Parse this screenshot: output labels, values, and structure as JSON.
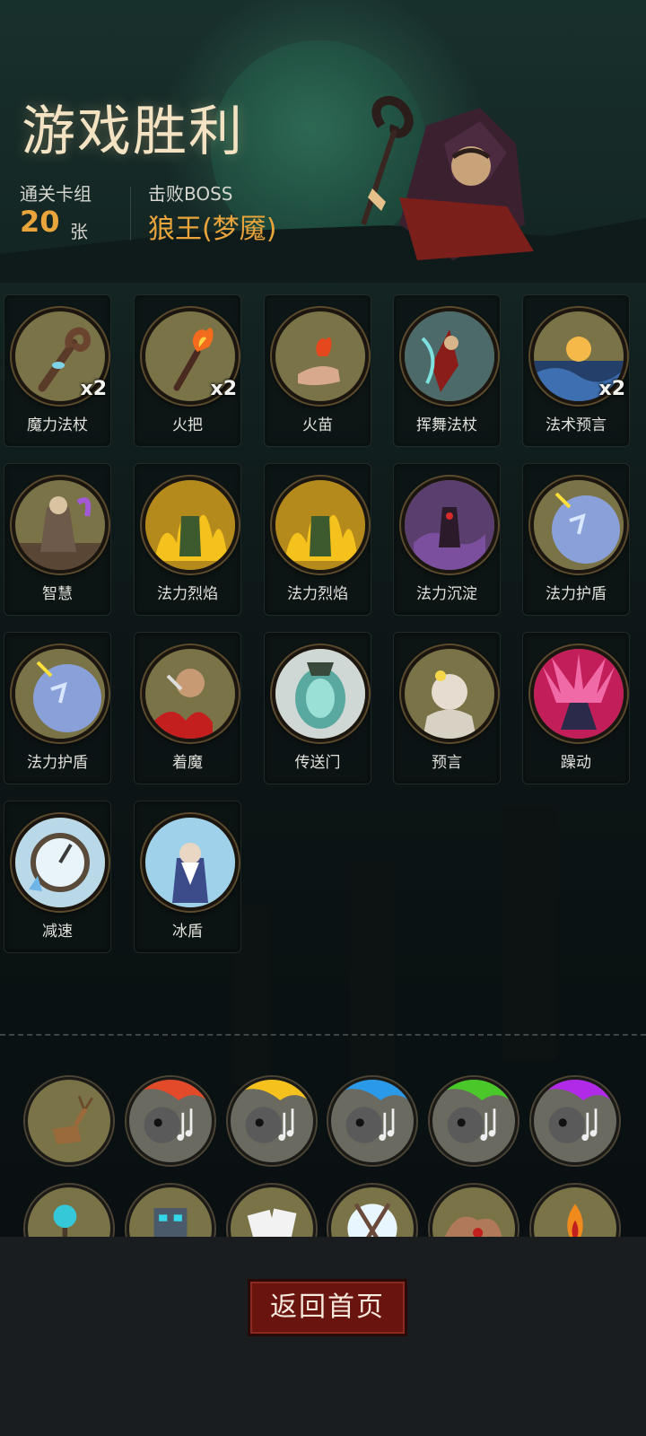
{
  "header": {
    "title": "游戏胜利",
    "deck_label": "通关卡组",
    "deck_count": "20",
    "deck_unit": "张",
    "boss_label": "击败BOSS",
    "boss_name": "狼王(梦魇)"
  },
  "cards": [
    {
      "name": "魔力法杖",
      "count": "x2",
      "icon": "magic-staff-icon",
      "color": "#7a7348"
    },
    {
      "name": "火把",
      "count": "x2",
      "icon": "torch-icon",
      "color": "#7a7348"
    },
    {
      "name": "火苗",
      "count": "",
      "icon": "fire-hand-icon",
      "color": "#7a7348"
    },
    {
      "name": "挥舞法杖",
      "count": "",
      "icon": "wave-staff-icon",
      "color": "#7a7348"
    },
    {
      "name": "法术预言",
      "count": "x2",
      "icon": "spell-prophecy-icon",
      "color": "#7a7348"
    },
    {
      "name": "智慧",
      "count": "",
      "icon": "wisdom-icon",
      "color": "#7a7348"
    },
    {
      "name": "法力烈焰",
      "count": "",
      "icon": "mana-flame-icon",
      "color": "#7a7348"
    },
    {
      "name": "法力烈焰",
      "count": "",
      "icon": "mana-flame-icon",
      "color": "#7a7348"
    },
    {
      "name": "法力沉淀",
      "count": "",
      "icon": "mana-settle-icon",
      "color": "#7a7348"
    },
    {
      "name": "法力护盾",
      "count": "",
      "icon": "mana-shield-icon",
      "color": "#7a7348"
    },
    {
      "name": "法力护盾",
      "count": "",
      "icon": "mana-shield-icon",
      "color": "#7a7348"
    },
    {
      "name": "着魔",
      "count": "",
      "icon": "possessed-icon",
      "color": "#7a7348"
    },
    {
      "name": "传送门",
      "count": "",
      "icon": "portal-icon",
      "color": "#7a7348"
    },
    {
      "name": "预言",
      "count": "",
      "icon": "prophecy-icon",
      "color": "#7a7348"
    },
    {
      "name": "躁动",
      "count": "",
      "icon": "restless-icon",
      "color": "#7a7348"
    },
    {
      "name": "减速",
      "count": "",
      "icon": "slow-icon",
      "color": "#7a7348"
    },
    {
      "name": "冰盾",
      "count": "",
      "icon": "ice-shield-icon",
      "color": "#7a7348"
    }
  ],
  "relics_row1": [
    "deer-icon",
    "music-skull-red-icon",
    "music-skull-yellow-icon",
    "music-skull-blue-icon",
    "music-skull-green-icon",
    "music-skull-purple-icon"
  ],
  "relics_row2": [
    "orb-staff-icon",
    "robot-icon",
    "playing-cards-icon",
    "ice-crystal-icon",
    "muscle-icon",
    "flame-gem-icon"
  ],
  "footer": {
    "back_home": "返回首页"
  },
  "colors": {
    "title": "#f3e3c3",
    "accent": "#e9a53c",
    "button": "#6a1410"
  }
}
